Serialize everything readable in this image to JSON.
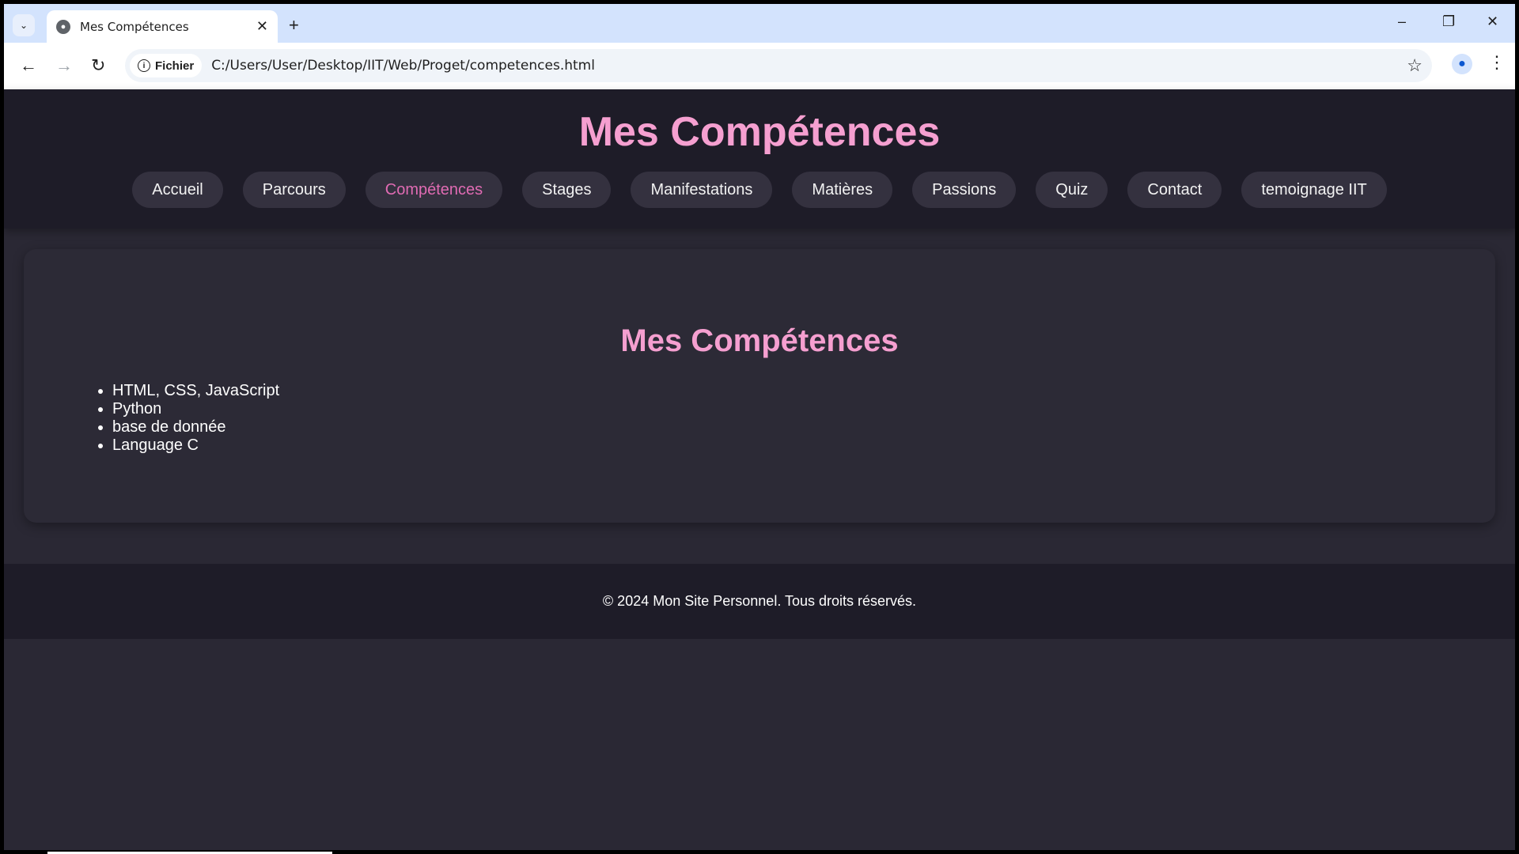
{
  "browser": {
    "tab_title": "Mes Compétences",
    "site_chip": "Fichier",
    "url": "C:/Users/User/Desktop/IIT/Web/Proget/competences.html"
  },
  "header": {
    "title": "Mes Compétences",
    "nav": [
      {
        "label": "Accueil"
      },
      {
        "label": "Parcours"
      },
      {
        "label": "Compétences",
        "active": true
      },
      {
        "label": "Stages"
      },
      {
        "label": "Manifestations"
      },
      {
        "label": "Matières"
      },
      {
        "label": "Passions"
      },
      {
        "label": "Quiz"
      },
      {
        "label": "Contact"
      },
      {
        "label": "temoignage IIT"
      }
    ]
  },
  "main": {
    "title": "Mes Compétences",
    "skills": [
      "HTML, CSS, JavaScript",
      "Python",
      "base de donnée",
      "Language C"
    ]
  },
  "footer": {
    "text": "© 2024 Mon Site Personnel. Tous droits réservés."
  },
  "colors": {
    "accent": "#f59fd0",
    "active_link": "#e06bb3",
    "header_bg": "#1e1c28",
    "page_bg": "#2a2834"
  }
}
